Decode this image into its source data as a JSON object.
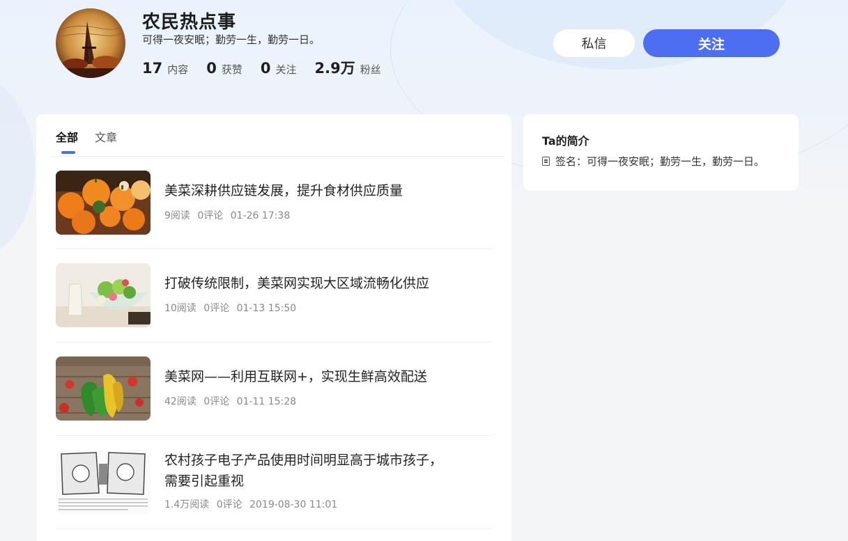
{
  "profile": {
    "name": "农民热点事",
    "signature": "可得一夜安眠；勤劳一生，勤劳一日。",
    "stats": [
      {
        "value": "17",
        "label": "内容"
      },
      {
        "value": "0",
        "label": "获赞"
      },
      {
        "value": "0",
        "label": "关注"
      },
      {
        "value": "2.9万",
        "label": "粉丝"
      }
    ]
  },
  "actions": {
    "message_label": "私信",
    "follow_label": "关注"
  },
  "tabs": [
    {
      "label": "全部",
      "active": true
    },
    {
      "label": "文章",
      "active": false
    }
  ],
  "articles": [
    {
      "title": "美菜深耕供应链发展，提升食材供应质量",
      "reads": "9阅读",
      "comments": "0评论",
      "time": "01-26 17:38",
      "thumb_icon": "pumpkins-image"
    },
    {
      "title": "打破传统限制，美菜网实现大区域流畅化供应",
      "reads": "10阅读",
      "comments": "0评论",
      "time": "01-13 15:50",
      "thumb_icon": "salad-image"
    },
    {
      "title": "美菜网——利用互联网+，实现生鲜高效配送",
      "reads": "42阅读",
      "comments": "0评论",
      "time": "01-11 15:28",
      "thumb_icon": "peppers-image"
    },
    {
      "title": "农村孩子电子产品使用时间明显高于城市孩子，需要引起重视",
      "reads": "1.4万阅读",
      "comments": "0评论",
      "time": "2019-08-30 11:01",
      "thumb_icon": "comic-image"
    }
  ],
  "sidebar": {
    "title": "Ta的简介",
    "signature_label": "签名",
    "signature_line": "签名：可得一夜安眠；勤劳一生，勤劳一日。"
  },
  "colors": {
    "accent": "#4e6ef2",
    "background": "#f4f5f7"
  }
}
